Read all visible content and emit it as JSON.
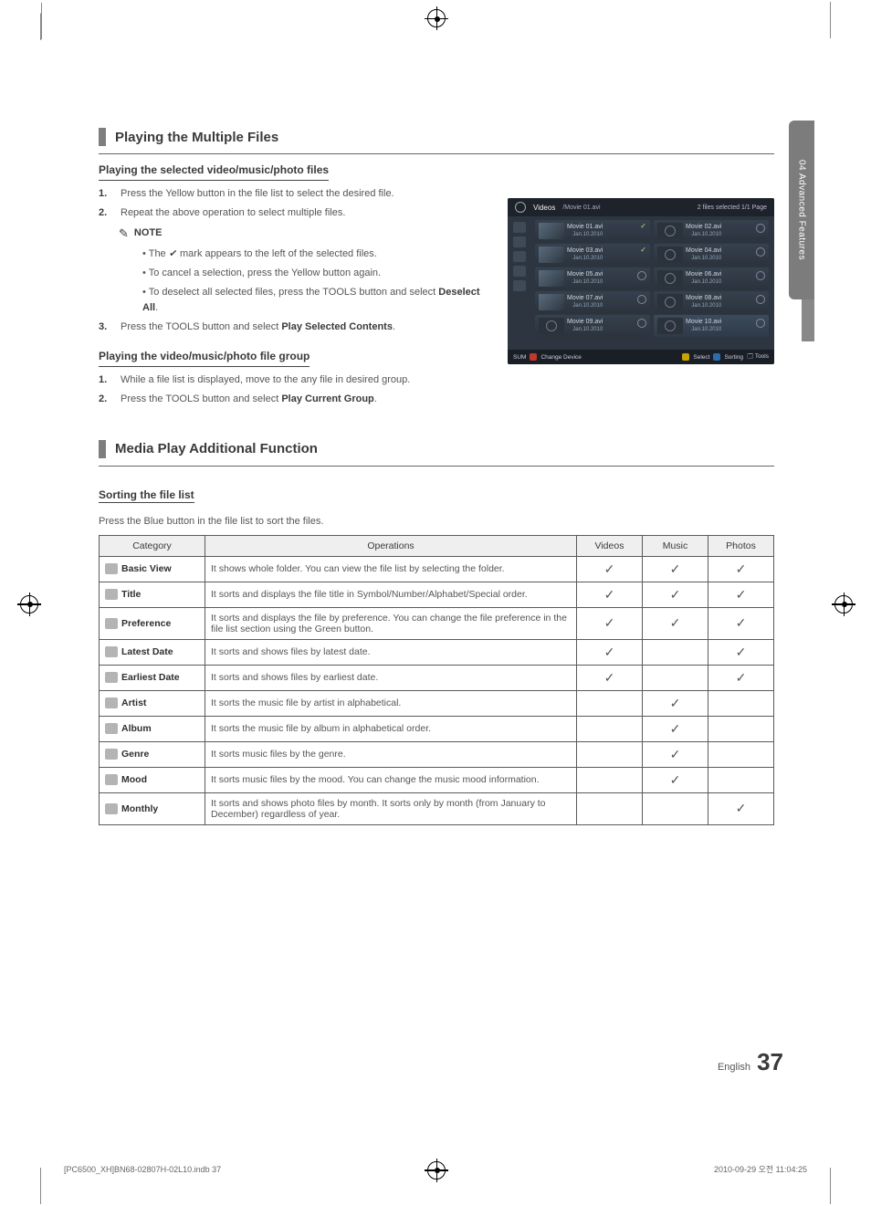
{
  "sideTab": "04    Advanced Features",
  "sections": {
    "multi": {
      "title": "Playing the Multiple Files",
      "sub1": "Playing the selected video/music/photo files",
      "steps1": [
        "Press the Yellow button in the file list to select the desired file.",
        "Repeat the above operation to select multiple files."
      ],
      "noteLabel": "NOTE",
      "notes": [
        "The  ✓  mark appears to the left of the selected files.",
        "To cancel a selection, press the Yellow button again.",
        "To deselect all selected files, press the TOOLS button and select Deselect All."
      ],
      "step3_pre": "Press the TOOLS button and select ",
      "step3_bold": "Play Selected Contents",
      "sub2": "Playing the video/music/photo file group",
      "steps2": [
        "While a file list is displayed, move to the any file in desired group.",
        "Press the TOOLS button and select Play Current Group."
      ]
    },
    "addl": {
      "title": "Media Play Additional Function",
      "sub": "Sorting the file list",
      "desc": "Press the Blue button in the file list to sort the files."
    }
  },
  "tv": {
    "label": "Videos",
    "path": "/Movie 01.avi",
    "selInfo": "2 files selected    1/1 Page",
    "files": [
      {
        "name": "Movie 01.avi",
        "date": "Jan.10.2010",
        "chk": true,
        "thumb": true
      },
      {
        "name": "Movie 02.avi",
        "date": "Jan.10.2010",
        "chk": false,
        "thumb": false
      },
      {
        "name": "Movie 03.avi",
        "date": "Jan.10.2010",
        "chk": true,
        "thumb": true
      },
      {
        "name": "Movie 04.avi",
        "date": "Jan.10.2010",
        "chk": false,
        "thumb": false
      },
      {
        "name": "Movie 05.avi",
        "date": "Jan.10.2010",
        "chk": false,
        "thumb": true
      },
      {
        "name": "Movie 06.avi",
        "date": "Jan.10.2010",
        "chk": false,
        "thumb": false
      },
      {
        "name": "Movie 07.avi",
        "date": "Jan.10.2010",
        "chk": false,
        "thumb": true
      },
      {
        "name": "Movie 08.avi",
        "date": "Jan.10.2010",
        "chk": false,
        "thumb": false
      },
      {
        "name": "Movie 09.avi",
        "date": "Jan.10.2010",
        "chk": false,
        "thumb": false,
        "noimg": true
      },
      {
        "name": "Movie 10.avi",
        "date": "Jan.10.2010",
        "chk": false,
        "thumb": false,
        "hl": true
      }
    ],
    "bottom": {
      "sum": "SUM",
      "a": "Change Device",
      "c": "Select",
      "d": "Sorting",
      "t": "Tools"
    }
  },
  "table": {
    "headers": [
      "Category",
      "Operations",
      "Videos",
      "Music",
      "Photos"
    ],
    "rows": [
      {
        "cat": "Basic View",
        "op": "It shows whole folder. You can view the file list by selecting the folder.",
        "v": true,
        "m": true,
        "p": true
      },
      {
        "cat": "Title",
        "op": "It sorts and displays the file title in Symbol/Number/Alphabet/Special order.",
        "v": true,
        "m": true,
        "p": true
      },
      {
        "cat": "Preference",
        "op": "It sorts and displays the file by preference. You can change the file preference in the file list section using the Green button.",
        "v": true,
        "m": true,
        "p": true
      },
      {
        "cat": "Latest Date",
        "op": "It sorts and shows files by latest date.",
        "v": true,
        "m": false,
        "p": true
      },
      {
        "cat": "Earliest Date",
        "op": "It sorts and shows files by earliest date.",
        "v": true,
        "m": false,
        "p": true
      },
      {
        "cat": "Artist",
        "op": "It sorts the music file by artist in alphabetical.",
        "v": false,
        "m": true,
        "p": false
      },
      {
        "cat": "Album",
        "op": "It sorts the music file by album in alphabetical order.",
        "v": false,
        "m": true,
        "p": false
      },
      {
        "cat": "Genre",
        "op": "It sorts music files by the genre.",
        "v": false,
        "m": true,
        "p": false
      },
      {
        "cat": "Mood",
        "op": "It sorts music files by the mood. You can change the music mood information.",
        "v": false,
        "m": true,
        "p": false
      },
      {
        "cat": "Monthly",
        "op": "It sorts and shows photo files by month. It sorts only by month (from January to December) regardless of year.",
        "v": false,
        "m": false,
        "p": true
      }
    ]
  },
  "footer": {
    "lang": "English",
    "page": "37"
  },
  "printLine": {
    "left": "[PC6500_XH]BN68-02807H-02L10.indb   37",
    "right": "2010-09-29   오전 11:04:25"
  }
}
